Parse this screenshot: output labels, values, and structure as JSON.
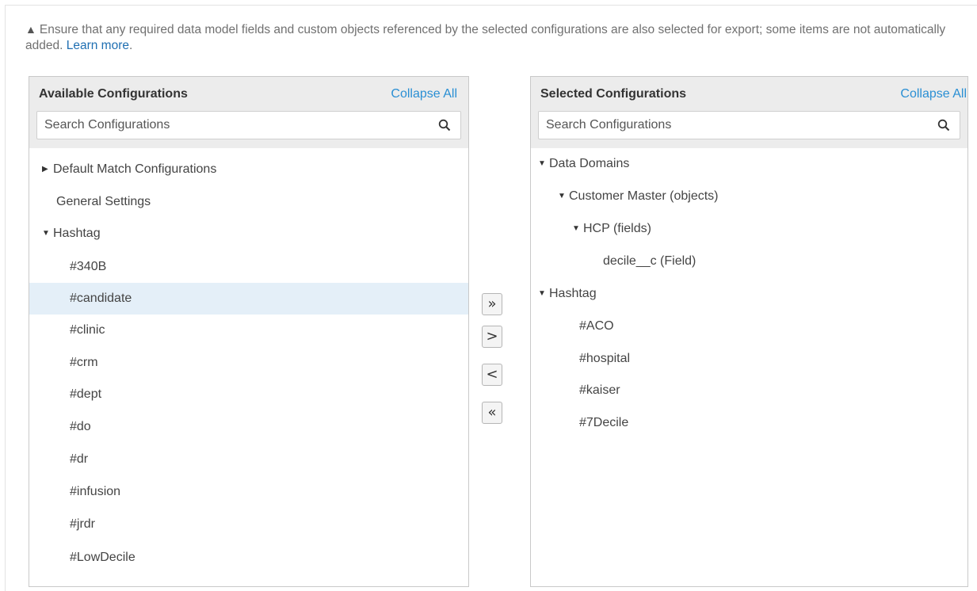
{
  "notice": {
    "warning_icon": "warning-triangle-icon",
    "text": "Ensure that any required data model fields and custom objects referenced by the selected configurations are also selected for export; some items are not automatically added.",
    "link": "Learn more",
    "trailing": "."
  },
  "available": {
    "title": "Available Configurations",
    "collapse": "Collapse All",
    "search_placeholder": "Search Configurations",
    "items": [
      {
        "label": "Default Match Configurations",
        "caret": "▶",
        "selected": false
      },
      {
        "label": "General Settings",
        "caret": "",
        "selected": false
      },
      {
        "label": "Hashtag",
        "caret": "▼",
        "selected": false
      },
      {
        "label": "#340B",
        "caret": "",
        "selected": false
      },
      {
        "label": "#candidate",
        "caret": "",
        "selected": true
      },
      {
        "label": "#clinic",
        "caret": "",
        "selected": false
      },
      {
        "label": "#crm",
        "caret": "",
        "selected": false
      },
      {
        "label": "#dept",
        "caret": "",
        "selected": false
      },
      {
        "label": "#do",
        "caret": "",
        "selected": false
      },
      {
        "label": "#dr",
        "caret": "",
        "selected": false
      },
      {
        "label": "#infusion",
        "caret": "",
        "selected": false
      },
      {
        "label": "#jrdr",
        "caret": "",
        "selected": false
      },
      {
        "label": "#LowDecile",
        "caret": "",
        "selected": false
      }
    ]
  },
  "selected": {
    "title": "Selected Configurations",
    "collapse": "Collapse All",
    "search_placeholder": "Search Configurations",
    "items": [
      {
        "label": "Data Domains",
        "caret": "▼"
      },
      {
        "label": "Customer Master (objects)",
        "caret": "▼"
      },
      {
        "label": "HCP (fields)",
        "caret": "▼"
      },
      {
        "label": "decile__c (Field)",
        "caret": ""
      },
      {
        "label": "Hashtag",
        "caret": "▼"
      },
      {
        "label": "#ACO",
        "caret": ""
      },
      {
        "label": "#hospital",
        "caret": ""
      },
      {
        "label": "#kaiser",
        "caret": ""
      },
      {
        "label": "#7Decile",
        "caret": ""
      }
    ]
  },
  "transfer": {
    "add_all": "»",
    "add": ">",
    "remove": "<",
    "remove_all": "«"
  }
}
